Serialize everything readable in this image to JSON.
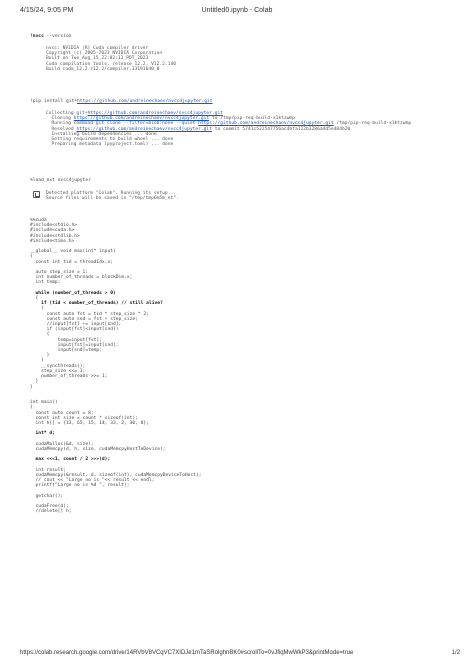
{
  "header": {
    "datetime": "4/15/24, 9:05 PM",
    "title": "Untitled0.ipynb - Colab"
  },
  "footer": {
    "url": "https://colab.research.google.com/drive/14RVbV8VCqVC7XIDJe1mTaSRolghnBK0#scrollTo=0vJfiqMwWkP3&printMode=true",
    "page": "1/2"
  },
  "cells": {
    "nvcc_cmd": {
      "prefix": "!nvcc",
      "rest": " --version"
    },
    "nvcc_output": [
      "nvcc: NVIDIA (R) Cuda compiler driver",
      "Copyright (c) 2005-2023 NVIDIA Corporation",
      "Built on Tue_Aug_15_22:02:13_PDT_2023",
      "Cuda compilation tools, release 12.2, V12.2.140",
      "Build cuda_12.2.r12.2/compiler.33191640_0"
    ],
    "pip_cmd": {
      "prefix": "!pip install git+",
      "link": "https://github.com/andreinechaev/nvcc4jupyter.git"
    },
    "pip_output": [
      {
        "pre": "Collecting git+",
        "link": "https://github.com/andreinechaev/nvcc4jupyter.git",
        "post": ""
      },
      {
        "pre": "  Cloning ",
        "link": "https://github.com/andreinechaev/nvcc4jupyter.git",
        "post": " to /tmp/pip-req-build-x1ktzwmp"
      },
      {
        "pre": "  Running command git clone --filter=blob:none --quiet ",
        "link": "https://github.com/andreinechaev/nvcc4jupyter.git",
        "post": " /tmp/pip-req-build-x1ktzwmp"
      },
      {
        "pre": "  Resolved ",
        "link": "https://github.com/andreinechaev/nvcc4jupyter.git",
        "post": " to commit 5741c522547756ac4bfa122b3286a4d5e404b20"
      },
      {
        "pre": "  Installing build dependencies ... done",
        "link": "",
        "post": ""
      },
      {
        "pre": "  Getting requirements to build wheel ... done",
        "link": "",
        "post": ""
      },
      {
        "pre": "  Preparing metadata (pyproject.toml) ... done",
        "link": "",
        "post": ""
      }
    ],
    "load_ext_cmd": "%load_ext nvcc4jupyter",
    "load_ext_output": [
      "Detected platform \"Colab\". Running its setup...",
      "Source files will be saved in \"/tmp/tmp6m5m_et\"."
    ],
    "cuda_code": [
      "%%cuda",
      "#include<stdio.h>",
      "#include<cuda.h>",
      "#include<stdlib.h>",
      "#include<time.h>",
      "",
      "__global__ void max(int* input)",
      "{",
      "  const int tid = threadIdx.x;",
      "",
      "  auto step_size = 1;",
      "  int number_of_threads = blockDim.x;",
      "  int temp;",
      "",
      "  while (number_of_threads > 0)",
      "  {",
      "    if (tid < number_of_threads) // still alive?",
      "    {",
      "      const auto fst = tid * step_size * 2;",
      "      const auto snd = fst + step_size;",
      "      //input[fst] += input[snd];",
      "      if (input[fst]<input[snd])",
      "      {",
      "          temp=input[fst];",
      "          input[fst]=input[snd];",
      "          input[snd]=temp;",
      "      }",
      "    }",
      "    __syncthreads();",
      "    step_size <<= 1;",
      "    number_of_threads >>= 1;",
      "  }",
      "}",
      "",
      "",
      "int main()",
      "{",
      "  const auto count = 8;",
      "  const int size = count * sizeof(int);",
      "  int h[] = {13, 65, 15, 14, 33, 2, 30, 8};",
      "",
      "  int* d;",
      "",
      "  cudaMalloc(&d, size);",
      "  cudaMemcpy(d, h, size, cudaMemcpyHostToDevice);",
      "",
      "  max <<<1, count / 2 >>>(d);",
      "",
      "  int result;",
      "  cudaMemcpy(&result, d, sizeof(int), cudaMemcpyDeviceToHost);",
      "  // cout << \"Large no is \"<< result << endl;",
      "  printf(\"Large no is %d \", result);",
      "",
      "  getchar();",
      "",
      "  cudaFree(d);",
      "  //delete[] h;"
    ]
  }
}
